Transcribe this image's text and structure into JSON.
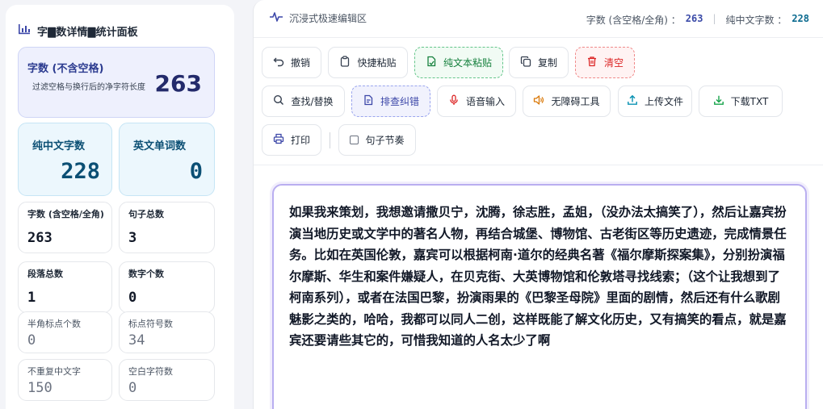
{
  "stats_panel": {
    "title": "字🀫数详情🀫统计面板",
    "main": {
      "label": "字数 (不含空格)",
      "sub": "过滤空格与换行后的净字符长度",
      "value": "263"
    },
    "pure": {
      "label": "纯中文字数",
      "value": "228"
    },
    "english": {
      "label": "英文单词数",
      "value": "0"
    },
    "with_spaces": {
      "label": "字数 (含空格/全角)",
      "value": "263"
    },
    "sentences": {
      "label": "句子总数",
      "value": "3"
    },
    "paragraphs": {
      "label": "段落总数",
      "value": "1"
    },
    "digits": {
      "label": "数字个数",
      "value": "0"
    },
    "halfwidth_punct": {
      "label": "半角标点个数",
      "value": "0"
    },
    "punct": {
      "label": "标点符号数",
      "value": "34"
    },
    "unique_cn": {
      "label": "不重复中文字",
      "value": "150"
    },
    "whitespace": {
      "label": "空白字符数",
      "value": "0"
    }
  },
  "editor_header": {
    "title": "沉浸式极速编辑区",
    "count_label": "字数 (含空格/全角) ：",
    "count_value": "263",
    "separator": "|",
    "pure_label": "纯中文字数 ：",
    "pure_value": "228"
  },
  "toolbar": {
    "undo": "撤销",
    "quick_paste": "快捷粘贴",
    "plain_paste": "纯文本粘贴",
    "copy": "复制",
    "clear": "清空",
    "find_replace": "查找/替换",
    "proofread": "排查纠错",
    "voice_input": "语音输入",
    "accessibility": "无障碍工具",
    "upload": "上传文件",
    "download": "下载TXT",
    "print": "打印",
    "sentence_rhythm": "句子节奏"
  },
  "editor": {
    "content": "如果我来策划，我想邀请撒贝宁，沈腾，徐志胜，孟姐，（没办法太搞笑了），然后让嘉宾扮演当地历史或文学中的著名人物，再结合城堡、博物馆、古老街区等历史遗迹，完成情景任务。比如在英国伦敦，嘉宾可以根据柯南·道尔的经典名著《福尔摩斯探案集》，分别扮演福尔摩斯、华生和案件嫌疑人，在贝克街、大英博物馆和伦敦塔寻找线索；（这个让我想到了柯南系列），或者在法国巴黎，扮演雨果的《巴黎圣母院》里面的剧情，然后还有什么歌剧魅影之类的，哈哈，我都可以同人二创，这样既能了解文化历史，又有搞笑的看点，就是嘉宾还要请些其它的，可惜我知道的人名太少了啊"
  },
  "colors": {
    "accent_indigo": "#3c47a8",
    "accent_teal": "#0b4f74",
    "green": "#15803d",
    "red": "#dc2626",
    "editor_border": "#b9aef0"
  },
  "icons": [
    "chart-icon",
    "pulse-icon",
    "undo-icon",
    "clipboard-icon",
    "paste-plain-icon",
    "copy-icon",
    "trash-icon",
    "search-icon",
    "proofread-icon",
    "mic-icon",
    "speaker-icon",
    "upload-icon",
    "download-icon",
    "printer-icon"
  ]
}
